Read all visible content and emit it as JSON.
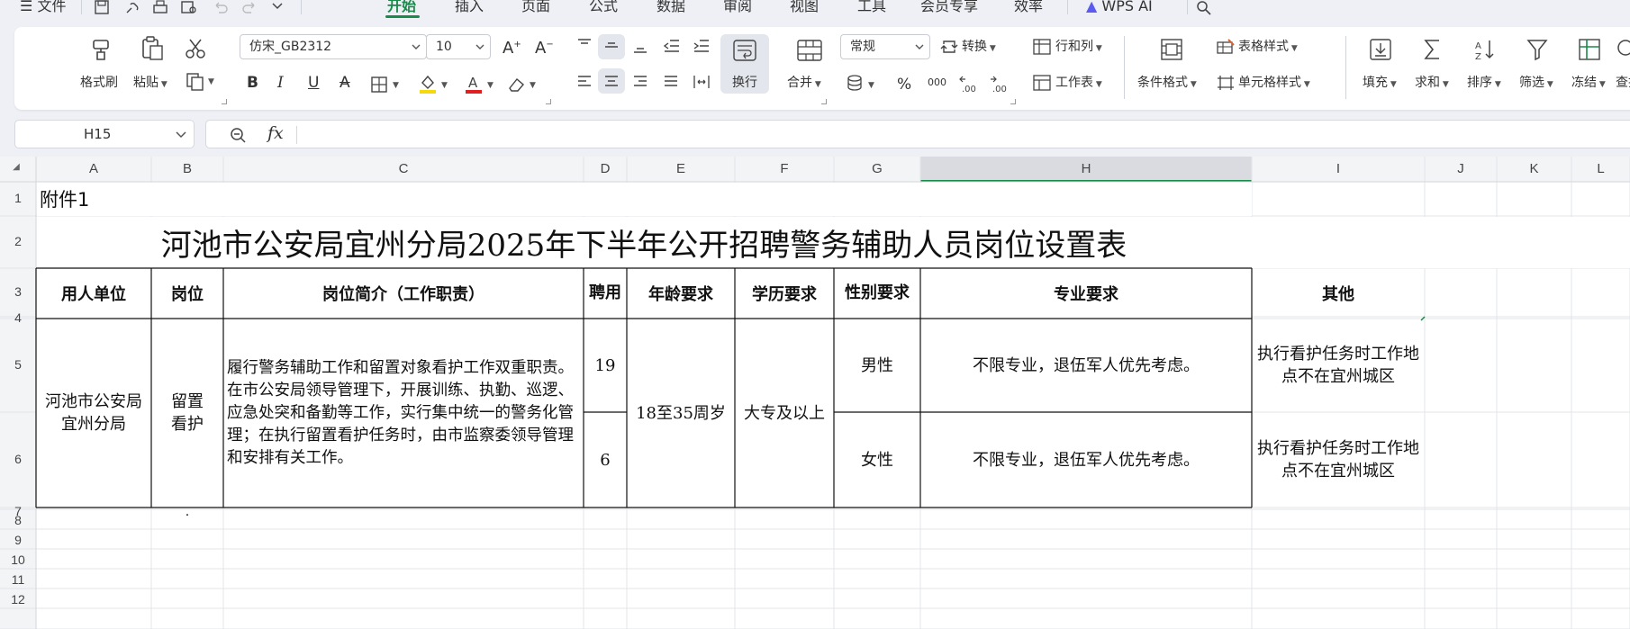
{
  "menu": {
    "file_label": "文件",
    "tabs": [
      "开始",
      "插入",
      "页面",
      "公式",
      "数据",
      "审阅",
      "视图",
      "工具",
      "会员专享",
      "效率"
    ],
    "active_tab": "开始",
    "wps_ai_label": "WPS AI"
  },
  "ribbon": {
    "format_painter": "格式刷",
    "paste": "粘贴",
    "font_name": "仿宋_GB2312",
    "font_size": "10",
    "wrap_text": "换行",
    "merge": "合并",
    "number_format": "常规",
    "convert": "转换",
    "rows_cols": "行和列",
    "worksheet": "工作表",
    "conditional_format": "条件格式",
    "table_style": "表格样式",
    "cell_style": "单元格样式",
    "fill": "填充",
    "sum": "求和",
    "sort": "排序",
    "filter": "筛选",
    "freeze": "冻结",
    "find": "查找",
    "percent_symbol": "%",
    "thousands_symbol": "000"
  },
  "formula_bar": {
    "name_box": "H15",
    "fx_label": "fx",
    "content": ""
  },
  "sheet": {
    "columns": [
      "A",
      "B",
      "C",
      "D",
      "E",
      "F",
      "G",
      "H",
      "I",
      "J",
      "K",
      "L"
    ],
    "rows": [
      "1",
      "2",
      "3",
      "4",
      "5",
      "6",
      "7",
      "8",
      "9",
      "10",
      "11",
      "12"
    ],
    "selected_column": "H",
    "annex": "附件1",
    "title": "河池市公安局宜州分局2025年下半年公开招聘警务辅助人员岗位设置表",
    "headers": {
      "unit": "用人单位",
      "post": "岗位",
      "duty": "岗位简介（工作职责）",
      "hire": "聘用",
      "age": "年龄要求",
      "edu": "学历要求",
      "gender": "性别要求",
      "major": "专业要求",
      "other": "其他"
    },
    "body": {
      "unit": "河池市公安局宜州分局",
      "post": "留置看护",
      "duty": "履行警务辅助工作和留置对象看护工作双重职责。在市公安局领导管理下，开展训练、执勤、巡逻、应急处突和备勤等工作，实行集中统一的警务化管理；在执行留置看护任务时，由市监察委领导管理和安排有关工作。",
      "age": "18至35周岁",
      "edu": "大专及以上",
      "male_count": "19",
      "female_count": "6",
      "male": "男性",
      "female": "女性",
      "major_male": "不限专业，退伍军人优先考虑。",
      "major_female": "不限专业，退伍军人优先考虑。",
      "other_male": "执行看护任务时工作地点不在宜州城区",
      "other_female": "执行看护任务时工作地点不在宜州城区",
      "row7_mark": "."
    }
  },
  "colors": {
    "accent_green": "#1a8a4a",
    "chrome_bg": "#eef0f5",
    "grid_line": "#e2e4e8",
    "border": "#111111"
  }
}
